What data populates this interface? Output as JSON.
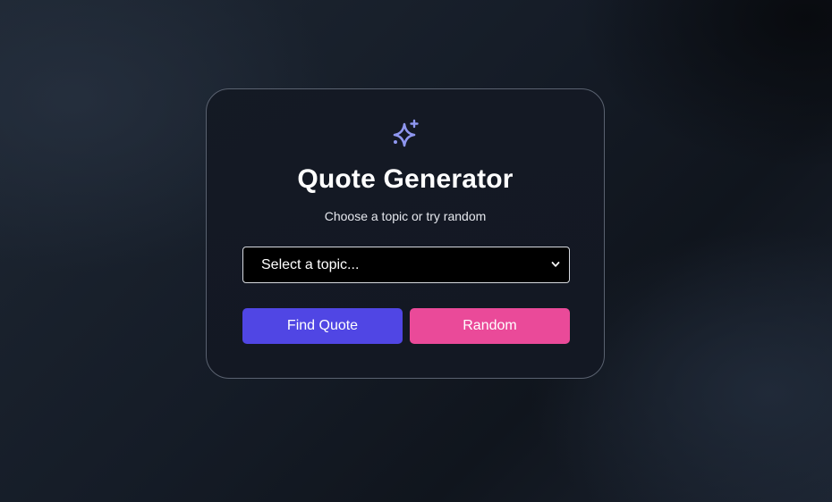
{
  "card": {
    "icon": "sparkle-icon",
    "title": "Quote Generator",
    "subtitle": "Choose a topic or try random"
  },
  "topic_select": {
    "selected": "Select a topic..."
  },
  "buttons": {
    "find_label": "Find Quote",
    "random_label": "Random"
  },
  "colors": {
    "accent_icon": "#8f97f0",
    "find_button": "#5046e4",
    "random_button": "#ea4a99",
    "card_background": "#131824",
    "select_background": "#000000"
  }
}
